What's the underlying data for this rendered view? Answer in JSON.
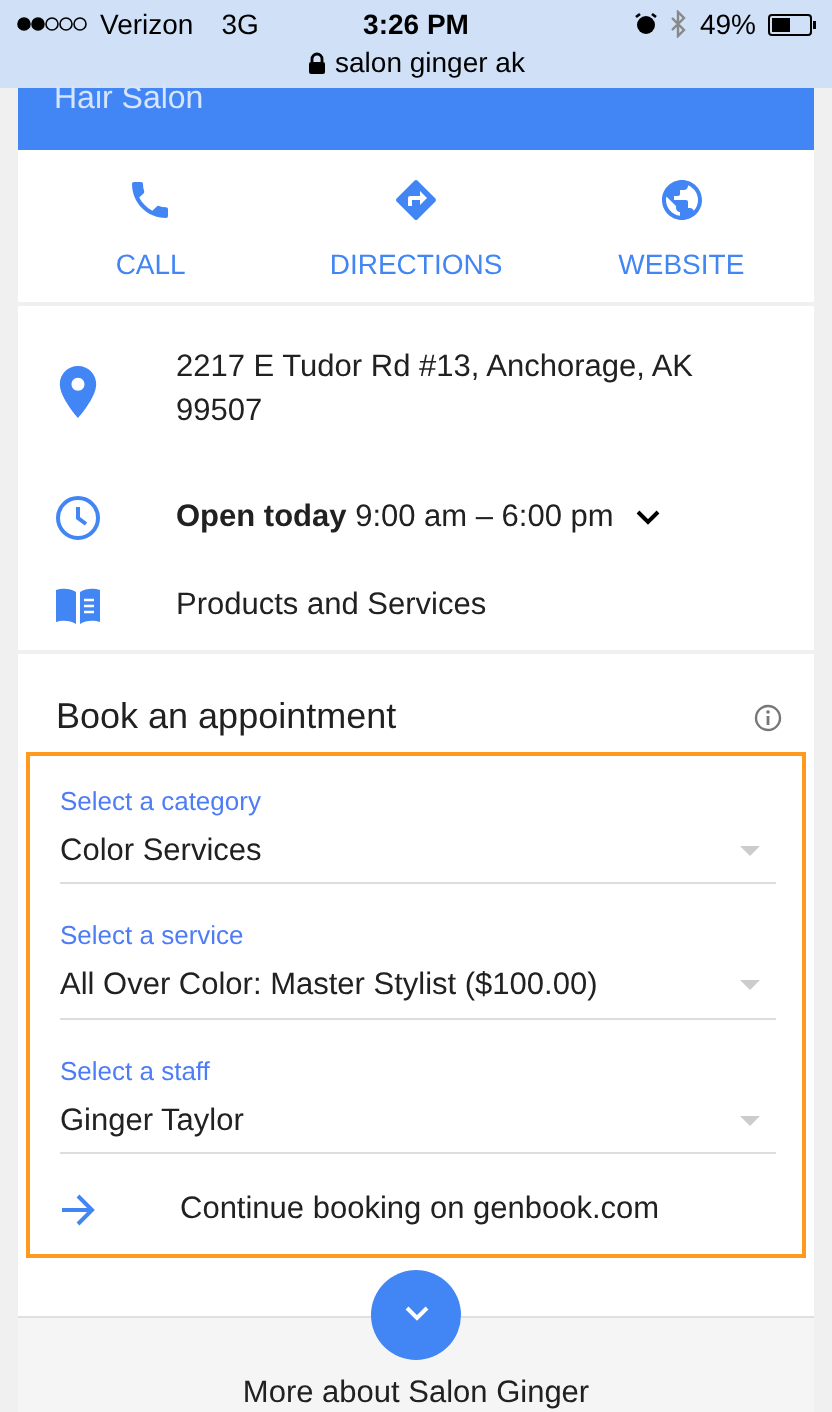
{
  "status_bar": {
    "carrier": "Verizon",
    "network": "3G",
    "time": "3:26 PM",
    "battery": "49%",
    "url": "salon ginger ak"
  },
  "header": {
    "subtitle": "Hair Salon"
  },
  "actions": [
    {
      "kind": "call",
      "label": "CALL"
    },
    {
      "kind": "directions",
      "label": "DIRECTIONS"
    },
    {
      "kind": "website",
      "label": "WEBSITE"
    }
  ],
  "info": [
    {
      "kind": "address",
      "text": "2217 E Tudor Rd #13, Anchorage, AK 99507"
    },
    {
      "kind": "hours",
      "text": "**Open today** 9:00 am – 6:00 pm"
    },
    {
      "kind": "products",
      "text": "Products and Services"
    }
  ],
  "booking": {
    "title": "Book an appointment",
    "highlighted": true,
    "selects": [
      {
        "label": "Select a category",
        "value": "Color Services"
      },
      {
        "label": "Select a service",
        "value": "All Over Color: Master Stylist ($100.00)"
      },
      {
        "label": "Select a staff",
        "value": "Ginger Taylor"
      }
    ],
    "continue": "Continue booking on genbook.com"
  },
  "more": {
    "label": "More about Salon Ginger"
  }
}
